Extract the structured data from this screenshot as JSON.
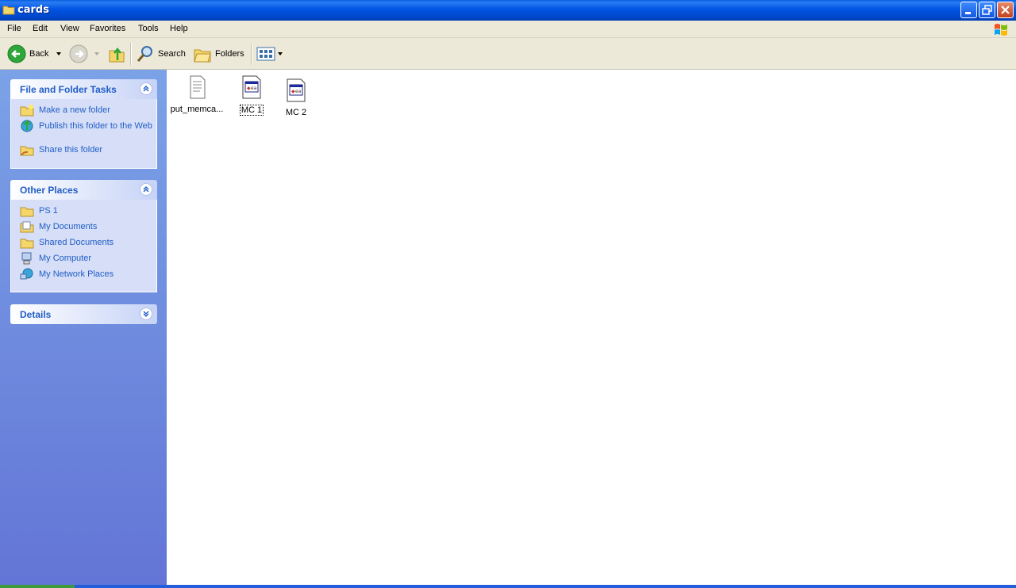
{
  "window": {
    "title": "cards"
  },
  "menu": [
    "File",
    "Edit",
    "View",
    "Favorites",
    "Tools",
    "Help"
  ],
  "toolbar": {
    "back_label": "Back",
    "search_label": "Search",
    "folders_label": "Folders"
  },
  "tasks_panel": {
    "title": "File and Folder Tasks",
    "items": [
      "Make a new folder",
      "Publish this folder to the Web",
      "Share this folder"
    ]
  },
  "places_panel": {
    "title": "Other Places",
    "items": [
      "PS 1",
      "My Documents",
      "Shared Documents",
      "My Computer",
      "My Network Places"
    ]
  },
  "details_panel": {
    "title": "Details"
  },
  "files": [
    {
      "name": "put_memca...",
      "icon": "text-file-icon"
    },
    {
      "name": "MC 1",
      "icon": "program-file-icon"
    },
    {
      "name": "MC 2",
      "icon": "program-file-icon"
    }
  ]
}
